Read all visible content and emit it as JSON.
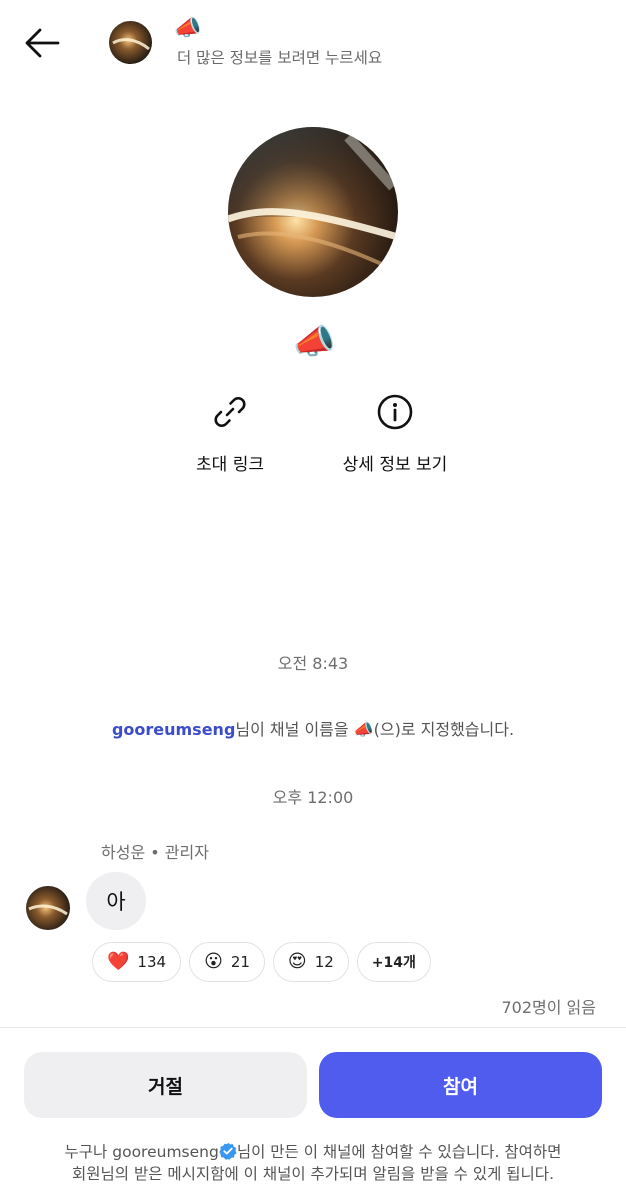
{
  "header": {
    "title_emoji": "📣",
    "subtitle": "더 많은 정보를 보려면 누르세요"
  },
  "profile": {
    "channel_emoji": "📣",
    "actions": [
      {
        "label": "초대 링크",
        "icon": "link-icon"
      },
      {
        "label": "상세 정보 보기",
        "icon": "info-icon"
      }
    ]
  },
  "timeline": {
    "timestamp1": "오전 8:43",
    "system_message": {
      "user": "gooreumseng",
      "text_before_emoji": "님이 채널 이름을 ",
      "emoji": "📣",
      "text_after_emoji": "(으)로 지정했습니다."
    },
    "timestamp2": "오후 12:00",
    "message": {
      "sender": "하성운 • 관리자",
      "text": "아",
      "reactions": [
        {
          "emoji": "❤️",
          "count": "134"
        },
        {
          "emoji": "😮",
          "count": "21"
        },
        {
          "emoji": "😍",
          "count": "12"
        }
      ],
      "more_reactions": "+14개",
      "read_count": "702명이 읽음"
    }
  },
  "footer": {
    "decline_label": "거절",
    "join_label": "참여",
    "notice_prefix": "누구나 ",
    "notice_user": "gooreumseng",
    "notice_line1_rest": "님이 만든 이 채널에 참여할 수 있습니다. 참여하면",
    "notice_line2": "회원님의 받은 메시지함에 이 채널이 추가되며 알림을 받을 수 있게 됩니다."
  },
  "colors": {
    "accent": "#4f5ced",
    "username": "#3c4dc9",
    "verified": "#3897f0"
  }
}
